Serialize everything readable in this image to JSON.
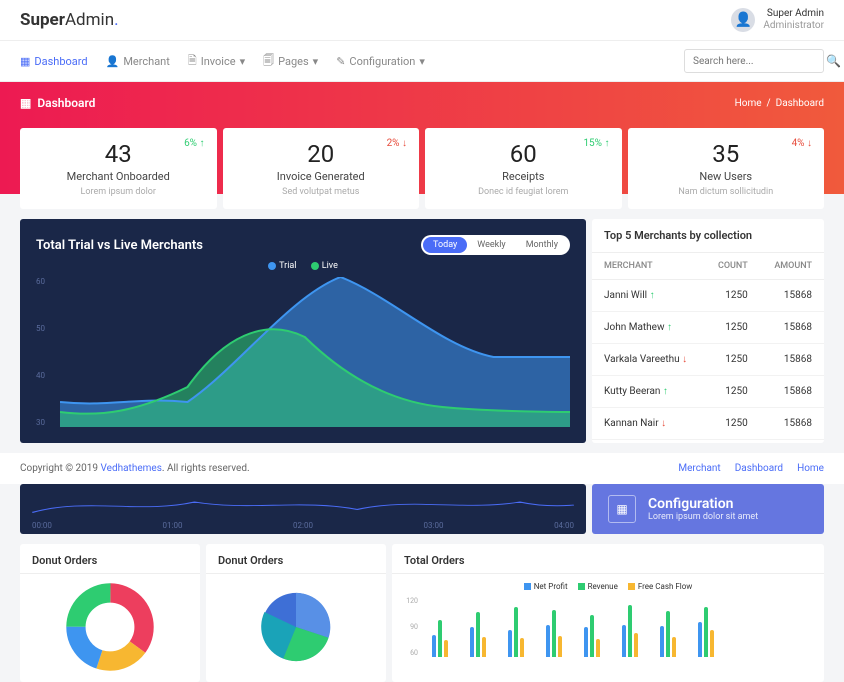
{
  "brand": {
    "a": "Super",
    "b": "Admin"
  },
  "user": {
    "name": "Super Admin",
    "role": "Administrator"
  },
  "nav": {
    "items": [
      {
        "label": "Dashboard"
      },
      {
        "label": "Merchant"
      },
      {
        "label": "Invoice"
      },
      {
        "label": "Pages"
      },
      {
        "label": "Configuration"
      }
    ]
  },
  "search": {
    "placeholder": "Search here..."
  },
  "hero": {
    "title": "Dashboard",
    "crumb_home": "Home",
    "crumb_current": "Dashboard"
  },
  "stats": [
    {
      "num": "43",
      "label": "Merchant Onboarded",
      "sub": "Lorem ipsum dolor",
      "delta": "6%",
      "dir": "up"
    },
    {
      "num": "20",
      "label": "Invoice Generated",
      "sub": "Sed volutpat metus",
      "delta": "2%",
      "dir": "down"
    },
    {
      "num": "60",
      "label": "Receipts",
      "sub": "Donec id feugiat lorem",
      "delta": "15%",
      "dir": "up"
    },
    {
      "num": "35",
      "label": "New Users",
      "sub": "Nam dictum sollicitudin",
      "delta": "4%",
      "dir": "down"
    }
  ],
  "area": {
    "title": "Total Trial vs Live Merchants",
    "toggles": [
      "Today",
      "Weekly",
      "Monthly"
    ],
    "legend": [
      {
        "name": "Trial",
        "color": "#3e95f0"
      },
      {
        "name": "Live",
        "color": "#2ecc71"
      }
    ]
  },
  "merchants": {
    "title": "Top 5 Merchants by collection",
    "headers": [
      "MERCHANT",
      "COUNT",
      "AMOUNT"
    ],
    "rows": [
      {
        "name": "Janni Will",
        "dir": "up",
        "count": "1250",
        "amount": "15868"
      },
      {
        "name": "John Mathew",
        "dir": "up",
        "count": "1250",
        "amount": "15868"
      },
      {
        "name": "Varkala Vareethu",
        "dir": "down",
        "count": "1250",
        "amount": "15868"
      },
      {
        "name": "Kutty Beeran",
        "dir": "up",
        "count": "1250",
        "amount": "15868"
      },
      {
        "name": "Kannan Nair",
        "dir": "down",
        "count": "1250",
        "amount": "15868"
      }
    ]
  },
  "footer": {
    "copyright": "Copyright © 2019 ",
    "brand": "Vedhathemes",
    "rest": ". All rights reserved.",
    "links": [
      "Merchant",
      "Dashboard",
      "Home"
    ]
  },
  "mini": {
    "xlabels": [
      "00:00",
      "01:00",
      "02:00",
      "03:00",
      "04:00"
    ]
  },
  "config": {
    "title": "Configuration",
    "sub": "Lorem ipsum dolor sit amet"
  },
  "donut1": {
    "title": "Donut Orders"
  },
  "donut2": {
    "title": "Donut Orders"
  },
  "total": {
    "title": "Total Orders",
    "legend": [
      {
        "name": "Net Profit",
        "color": "#3e95f0"
      },
      {
        "name": "Revenue",
        "color": "#2ecc71"
      },
      {
        "name": "Free Cash Flow",
        "color": "#f7b731"
      }
    ]
  },
  "chart_data": [
    {
      "type": "area",
      "title": "Total Trial vs Live Merchants",
      "ylabel": "",
      "xlabel": "",
      "ylim": [
        30,
        60
      ],
      "yticks": [
        30,
        40,
        50,
        60
      ],
      "x": [
        0,
        1,
        2,
        3,
        4,
        5,
        6,
        7,
        8,
        9
      ],
      "series": [
        {
          "name": "Trial",
          "color": "#3e95f0",
          "values": [
            35,
            34,
            36,
            35,
            42,
            56,
            60,
            56,
            46,
            44
          ]
        },
        {
          "name": "Live",
          "color": "#2ecc71",
          "values": [
            33,
            32,
            33,
            38,
            52,
            48,
            36,
            34,
            33,
            33
          ]
        }
      ]
    },
    {
      "type": "line",
      "title": "",
      "categories": [
        "00:00",
        "01:00",
        "02:00",
        "03:00",
        "04:00"
      ],
      "values": [
        20,
        60,
        30,
        55,
        25
      ]
    },
    {
      "type": "pie",
      "title": "Donut Orders",
      "donut": true,
      "series": [
        {
          "name": "A",
          "value": 35,
          "color": "#ed3e5e"
        },
        {
          "name": "B",
          "value": 20,
          "color": "#f7b731"
        },
        {
          "name": "C",
          "value": 20,
          "color": "#3e95f0"
        },
        {
          "name": "D",
          "value": 25,
          "color": "#2ecc71"
        }
      ]
    },
    {
      "type": "pie",
      "title": "Donut Orders",
      "donut": false,
      "series": [
        {
          "name": "A",
          "value": 30,
          "color": "#3e6fd6"
        },
        {
          "name": "B",
          "value": 25,
          "color": "#5890e6"
        },
        {
          "name": "C",
          "value": 25,
          "color": "#2ecc71"
        },
        {
          "name": "D",
          "value": 20,
          "color": "#1aa3b8"
        }
      ]
    },
    {
      "type": "bar",
      "title": "Total Orders",
      "ylim": [
        0,
        120
      ],
      "yticks": [
        60,
        90,
        120
      ],
      "categories": [
        "1",
        "2",
        "3",
        "4",
        "5",
        "6",
        "7",
        "8"
      ],
      "series": [
        {
          "name": "Net Profit",
          "color": "#3e95f0",
          "values": [
            45,
            60,
            55,
            65,
            60,
            65,
            62,
            70
          ]
        },
        {
          "name": "Revenue",
          "color": "#2ecc71",
          "values": [
            75,
            90,
            100,
            95,
            85,
            105,
            92,
            100
          ]
        },
        {
          "name": "Free Cash Flow",
          "color": "#f7b731",
          "values": [
            35,
            40,
            38,
            42,
            36,
            48,
            40,
            55
          ]
        }
      ]
    }
  ]
}
